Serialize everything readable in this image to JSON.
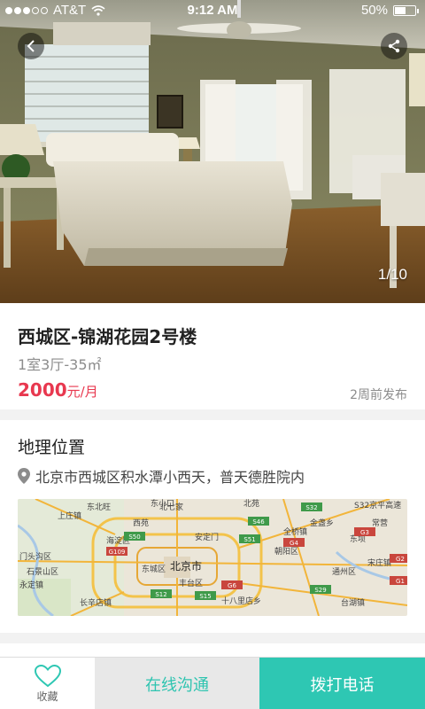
{
  "status_bar": {
    "carrier": "AT&T",
    "time": "9:12 AM",
    "battery": "50%",
    "battery_level": 0.5
  },
  "gallery": {
    "counter": "1/10",
    "back_icon": "chevron-left-icon",
    "share_icon": "share-icon"
  },
  "listing": {
    "title": "西城区-锦湖花园2号楼",
    "subtitle": "1室3厅-35㎡",
    "price": "2000",
    "price_unit": "元/月",
    "posted": "2周前发布"
  },
  "location": {
    "heading": "地理位置",
    "address": "北京市西城区积水潭小西天，普天德胜院内",
    "map": {
      "places": [
        "东北旺",
        "北七家",
        "S32京平高速",
        "东坝",
        "海淀区",
        "朝阳区",
        "石景山区",
        "东城区",
        "北京市",
        "丰台区",
        "通州区",
        "门头沟区",
        "永定镇",
        "长辛店镇",
        "十八里店乡",
        "台湖镇",
        "宋庄镇",
        "全桥镇",
        "安定门",
        "西苑",
        "东小口",
        "北苑",
        "上庄镇",
        "常营",
        "金盏乡"
      ],
      "road_labels": [
        "S32",
        "G109",
        "S50",
        "S51",
        "S46",
        "G4",
        "S12",
        "S15",
        "G6",
        "G1",
        "G2",
        "G3",
        "S29"
      ]
    }
  },
  "bottom_bar": {
    "favorite_label": "收藏",
    "chat_label": "在线沟通",
    "call_label": "拨打电话"
  },
  "colors": {
    "accent": "#2ec7b3",
    "price": "#e8384f",
    "chat_bg": "#e8e8e8"
  }
}
